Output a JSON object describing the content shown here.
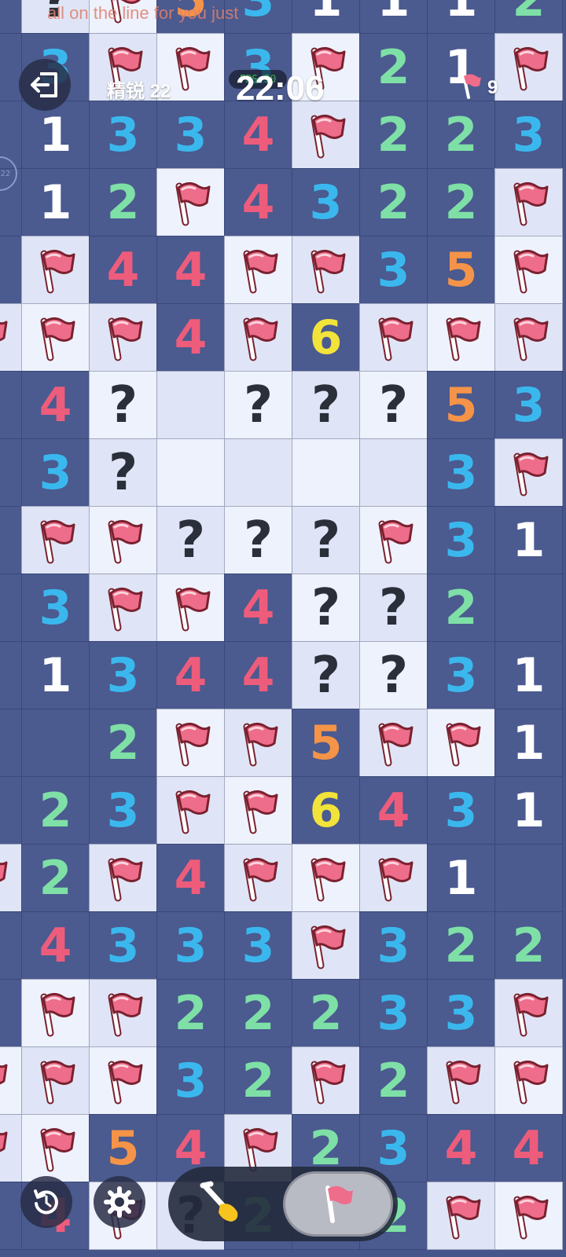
{
  "ticker_text": "all on the line for you just",
  "hud": {
    "exit_label": "exit",
    "difficulty_label": "精锐 22",
    "fps_label": "FPS:30",
    "timer": "22:06",
    "flags_remaining": "9",
    "side_badge": "22"
  },
  "controls": {
    "restart": "restart",
    "settings": "settings",
    "mode_dig": "dig",
    "mode_flag": "flag",
    "active_mode": "flag"
  },
  "colors": {
    "n1": "#ffffff",
    "n2": "#7ee0a6",
    "n3": "#3ab8ee",
    "n4": "#ee5c7c",
    "n5": "#f59448",
    "n6": "#f2e33a",
    "open_cell": "#4b5a8f",
    "closed_cell": "#eef2fc",
    "flag": "#ee6d8a"
  },
  "board": {
    "rows": [
      [
        "O",
        "?",
        "F",
        "5",
        "3",
        "1",
        "1",
        "1",
        "2"
      ],
      [
        "O",
        "3",
        "F",
        "F",
        "3",
        "F",
        "2",
        "1",
        "F"
      ],
      [
        "O",
        "1",
        "3",
        "3",
        "4",
        "F",
        "2",
        "2",
        "3"
      ],
      [
        "O",
        "1",
        "2",
        "F",
        "4",
        "3",
        "2",
        "2",
        "F"
      ],
      [
        "O",
        "F",
        "4",
        "4",
        "F",
        "F",
        "3",
        "5",
        "F"
      ],
      [
        "F",
        "F",
        "F",
        "4",
        "F",
        "6",
        "F",
        "F",
        "F"
      ],
      [
        "O",
        "4",
        "?",
        "E",
        "?",
        "?",
        "?",
        "5",
        "3"
      ],
      [
        "O",
        "3",
        "?",
        "E",
        "E",
        "E",
        "E",
        "3",
        "F"
      ],
      [
        "O",
        "F",
        "F",
        "?",
        "?",
        "?",
        "F",
        "3",
        "1"
      ],
      [
        "O",
        "3",
        "F",
        "F",
        "4",
        "?",
        "?",
        "2",
        "O"
      ],
      [
        "O",
        "1",
        "3",
        "4",
        "4",
        "?",
        "?",
        "3",
        "1"
      ],
      [
        "O",
        "O",
        "2",
        "F",
        "F",
        "5",
        "F",
        "F",
        "1"
      ],
      [
        "O",
        "2",
        "3",
        "F",
        "F",
        "6",
        "4",
        "3",
        "1"
      ],
      [
        "F",
        "2",
        "F",
        "4",
        "F",
        "F",
        "F",
        "1",
        "O"
      ],
      [
        "O",
        "4",
        "3",
        "3",
        "3",
        "F",
        "3",
        "2",
        "2"
      ],
      [
        "O",
        "F",
        "F",
        "2",
        "2",
        "2",
        "3",
        "3",
        "F"
      ],
      [
        "F",
        "F",
        "F",
        "3",
        "2",
        "F",
        "2",
        "F",
        "F"
      ],
      [
        "F",
        "F",
        "5",
        "4",
        "F",
        "2",
        "3",
        "4",
        "4"
      ],
      [
        "O",
        "4",
        "F",
        "?",
        "2",
        "1",
        "2",
        "F",
        "F"
      ]
    ]
  }
}
